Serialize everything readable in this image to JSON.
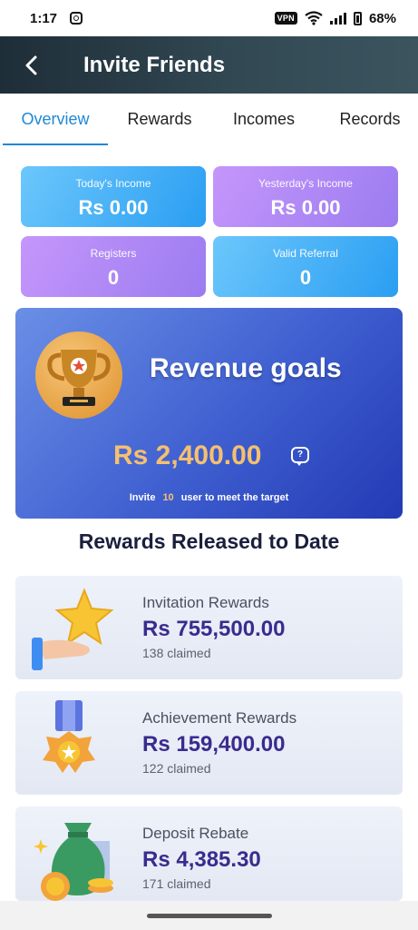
{
  "status_bar": {
    "time": "1:17",
    "vpn": "VPN",
    "battery": "68%"
  },
  "header": {
    "title": "Invite Friends"
  },
  "tabs": [
    {
      "label": "Overview",
      "active": true
    },
    {
      "label": "Rewards"
    },
    {
      "label": "Incomes"
    },
    {
      "label": "Records"
    }
  ],
  "stats": {
    "today": {
      "label": "Today's Income",
      "value": "Rs 0.00"
    },
    "yesterday": {
      "label": "Yesterday's Income",
      "value": "Rs 0.00"
    },
    "registers": {
      "label": "Registers",
      "value": "0"
    },
    "valid_referral": {
      "label": "Valid Referral",
      "value": "0"
    }
  },
  "revenue": {
    "title": "Revenue goals",
    "amount": "Rs 2,400.00",
    "help": "?",
    "note_prefix": "Invite",
    "note_count": "10",
    "note_suffix": "user to meet the target"
  },
  "section_title": "Rewards Released to Date",
  "rewards": [
    {
      "name": "Invitation Rewards",
      "amount": "Rs 755,500.00",
      "claimed": "138 claimed",
      "icon": "star-hand-icon"
    },
    {
      "name": "Achievement Rewards",
      "amount": "Rs 159,400.00",
      "claimed": "122 claimed",
      "icon": "medal-icon"
    },
    {
      "name": "Deposit Rebate",
      "amount": "Rs 4,385.30",
      "claimed": "171 claimed",
      "icon": "money-bag-icon"
    }
  ],
  "colors": {
    "accent": "#1f88d6",
    "header": "#2b3e48",
    "amount": "#3a2b8e",
    "gold": "#f5c06f"
  }
}
